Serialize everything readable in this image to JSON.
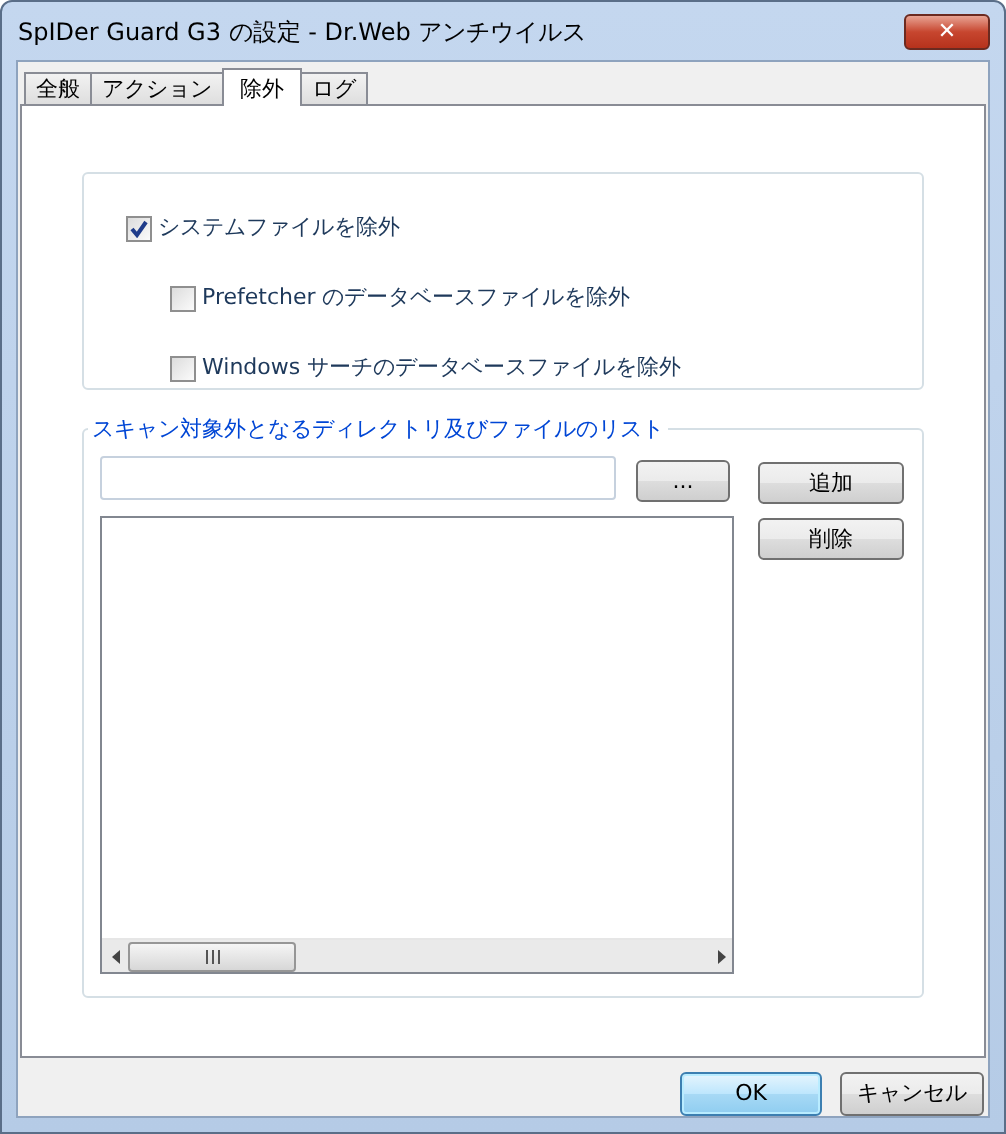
{
  "window": {
    "title": "SpIDer Guard G3 の設定 - Dr.Web アンチウイルス",
    "close": "✕"
  },
  "tabs": [
    {
      "label": "全般",
      "selected": false
    },
    {
      "label": "アクション",
      "selected": false
    },
    {
      "label": "除外",
      "selected": true
    },
    {
      "label": "ログ",
      "selected": false
    }
  ],
  "options": [
    {
      "label": "システムファイルを除外",
      "checked": true,
      "children": [
        {
          "label": "Prefetcher のデータベースファイルを除外",
          "checked": false
        },
        {
          "label": "Windows サーチのデータベースファイルを除外",
          "checked": false
        }
      ]
    }
  ],
  "exclusions": {
    "title": "スキャン対象外となるディレクトリ及びファイルのリスト",
    "browse_button": "...",
    "add_button": "追加",
    "remove_button": "削除"
  },
  "buttons": [
    {
      "label": "OK",
      "default": true
    },
    {
      "label": "キャンセル",
      "default": false
    }
  ]
}
